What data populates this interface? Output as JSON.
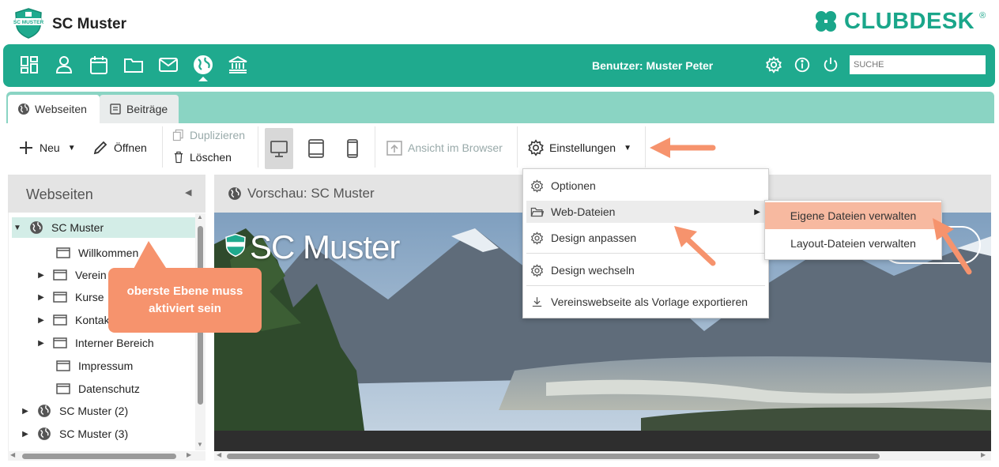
{
  "app": {
    "title": "SC Muster",
    "logo_text": "SC MUSTER",
    "brand": "CLUBDESK",
    "brand_reg": "®"
  },
  "mainnav": {
    "icons": [
      "dashboard-icon",
      "person-icon",
      "calendar-icon",
      "folder-icon",
      "mail-icon",
      "globe-icon",
      "bank-icon"
    ],
    "user_label": "Benutzer: Muster Peter",
    "search_placeholder": "SUCHE"
  },
  "tabs": [
    {
      "label": "Webseiten",
      "active": true
    },
    {
      "label": "Beiträge",
      "active": false
    }
  ],
  "toolbar": {
    "new_label": "Neu",
    "open_label": "Öffnen",
    "duplicate_label": "Duplizieren",
    "delete_label": "Löschen",
    "browser_label": "Ansicht im Browser",
    "settings_label": "Einstellungen"
  },
  "left_panel": {
    "title": "Webseiten",
    "tree": [
      {
        "label": "SC Muster",
        "expanded": true,
        "selected": true
      },
      {
        "label": "Willkommen"
      },
      {
        "label": "Verein"
      },
      {
        "label": "Kurse"
      },
      {
        "label": "Kontakt"
      },
      {
        "label": "Interner Bereich"
      },
      {
        "label": "Impressum"
      },
      {
        "label": "Datenschutz"
      },
      {
        "label": "SC Muster (2)"
      },
      {
        "label": "SC Muster (3)"
      }
    ]
  },
  "preview": {
    "title": "Vorschau: SC Muster",
    "site_title": "SC Muster"
  },
  "menu": {
    "items": [
      "Optionen",
      "Web-Dateien",
      "Design anpassen",
      "Design wechseln",
      "Vereinswebseite als Vorlage exportieren"
    ],
    "submenu": [
      "Eigene Dateien verwalten",
      "Layout-Dateien verwalten"
    ]
  },
  "callout": {
    "line1": "oberste Ebene muss",
    "line2": "aktiviert sein"
  },
  "colors": {
    "accent": "#1faa8e",
    "tab_bar": "#8ad4c3",
    "annotation": "#f6936d",
    "submenu_highlight": "#f7b9a0"
  }
}
